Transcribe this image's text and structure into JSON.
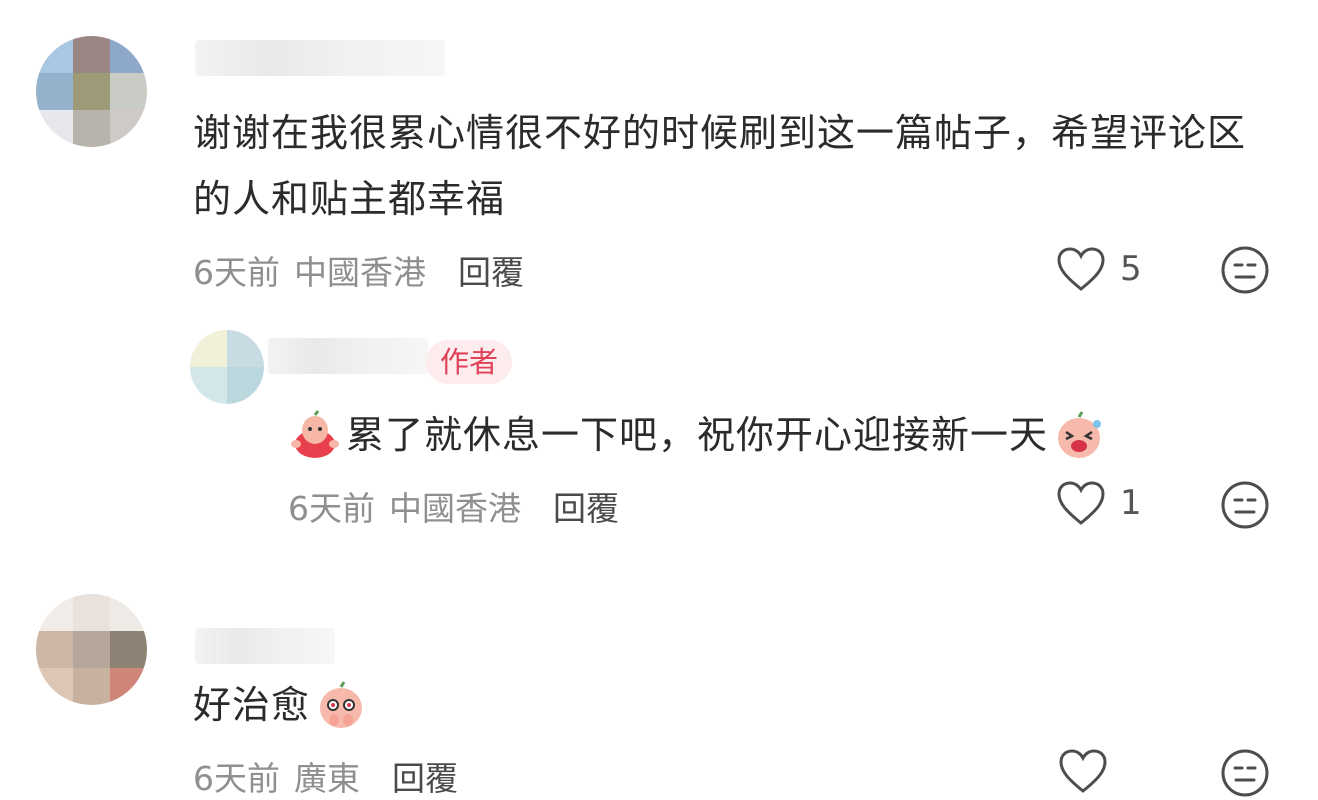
{
  "comments": [
    {
      "text": "谢谢在我很累心情很不好的时候刷到这一篇帖子，希望评论区的人和贴主都幸福",
      "time": "6天前",
      "location": "中國香港",
      "reply_label": "回覆",
      "likes": "5"
    },
    {
      "tag": "作者",
      "text": "累了就休息一下吧，祝你开心迎接新一天",
      "time": "6天前",
      "location": "中國香港",
      "reply_label": "回覆",
      "likes": "1"
    },
    {
      "text": "好治愈",
      "time": "6天前",
      "location": "廣東",
      "reply_label": "回覆",
      "likes": ""
    }
  ],
  "icons": {
    "like": "heart-outline-icon",
    "dislike": "neutral-face-icon",
    "emoji_a": "peach-character-sticker",
    "emoji_b": "peach-laughing-sticker",
    "emoji_c": "peach-touched-sticker"
  },
  "colors": {
    "author_tag_bg": "#fdeced",
    "author_tag_text": "#e0425a",
    "meta_text": "#8f8f8f"
  }
}
